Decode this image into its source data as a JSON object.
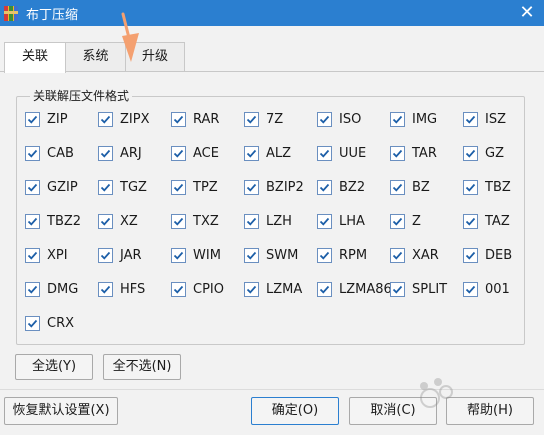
{
  "window": {
    "title": "布丁压缩",
    "close_glyph": "✕"
  },
  "tabs": [
    {
      "label": "关联",
      "active": true
    },
    {
      "label": "系统",
      "active": false
    },
    {
      "label": "升级",
      "active": false
    }
  ],
  "group": {
    "title": "关联解压文件格式",
    "formats": [
      {
        "label": "ZIP",
        "checked": true
      },
      {
        "label": "ZIPX",
        "checked": true
      },
      {
        "label": "RAR",
        "checked": true
      },
      {
        "label": "7Z",
        "checked": true
      },
      {
        "label": "ISO",
        "checked": true
      },
      {
        "label": "IMG",
        "checked": true
      },
      {
        "label": "ISZ",
        "checked": true
      },
      {
        "label": "CAB",
        "checked": true
      },
      {
        "label": "ARJ",
        "checked": true
      },
      {
        "label": "ACE",
        "checked": true
      },
      {
        "label": "ALZ",
        "checked": true
      },
      {
        "label": "UUE",
        "checked": true
      },
      {
        "label": "TAR",
        "checked": true
      },
      {
        "label": "GZ",
        "checked": true
      },
      {
        "label": "GZIP",
        "checked": true
      },
      {
        "label": "TGZ",
        "checked": true
      },
      {
        "label": "TPZ",
        "checked": true
      },
      {
        "label": "BZIP2",
        "checked": true
      },
      {
        "label": "BZ2",
        "checked": true
      },
      {
        "label": "BZ",
        "checked": true
      },
      {
        "label": "TBZ",
        "checked": true
      },
      {
        "label": "TBZ2",
        "checked": true
      },
      {
        "label": "XZ",
        "checked": true
      },
      {
        "label": "TXZ",
        "checked": true
      },
      {
        "label": "LZH",
        "checked": true
      },
      {
        "label": "LHA",
        "checked": true
      },
      {
        "label": "Z",
        "checked": true
      },
      {
        "label": "TAZ",
        "checked": true
      },
      {
        "label": "XPI",
        "checked": true
      },
      {
        "label": "JAR",
        "checked": true
      },
      {
        "label": "WIM",
        "checked": true
      },
      {
        "label": "SWM",
        "checked": true
      },
      {
        "label": "RPM",
        "checked": true
      },
      {
        "label": "XAR",
        "checked": true
      },
      {
        "label": "DEB",
        "checked": true
      },
      {
        "label": "DMG",
        "checked": true
      },
      {
        "label": "HFS",
        "checked": true
      },
      {
        "label": "CPIO",
        "checked": true
      },
      {
        "label": "LZMA",
        "checked": true
      },
      {
        "label": "LZMA86",
        "checked": true
      },
      {
        "label": "SPLIT",
        "checked": true
      },
      {
        "label": "001",
        "checked": true
      },
      {
        "label": "CRX",
        "checked": true
      }
    ]
  },
  "buttons": {
    "select_all": "全选(Y)",
    "select_none": "全不选(N)",
    "restore_defaults": "恢复默认设置(X)",
    "ok": "确定(O)",
    "cancel": "取消(C)",
    "help": "帮助(H)"
  },
  "colors": {
    "titlebar": "#2b7fd0",
    "checkbox_border": "#6a8fc0",
    "checkmark": "#1d5fa8",
    "arrow": "#f4a070"
  },
  "icons": {
    "app": "archive-app-icon",
    "close": "close-icon",
    "check": "check-icon",
    "arrow": "annotation-arrow-icon"
  }
}
